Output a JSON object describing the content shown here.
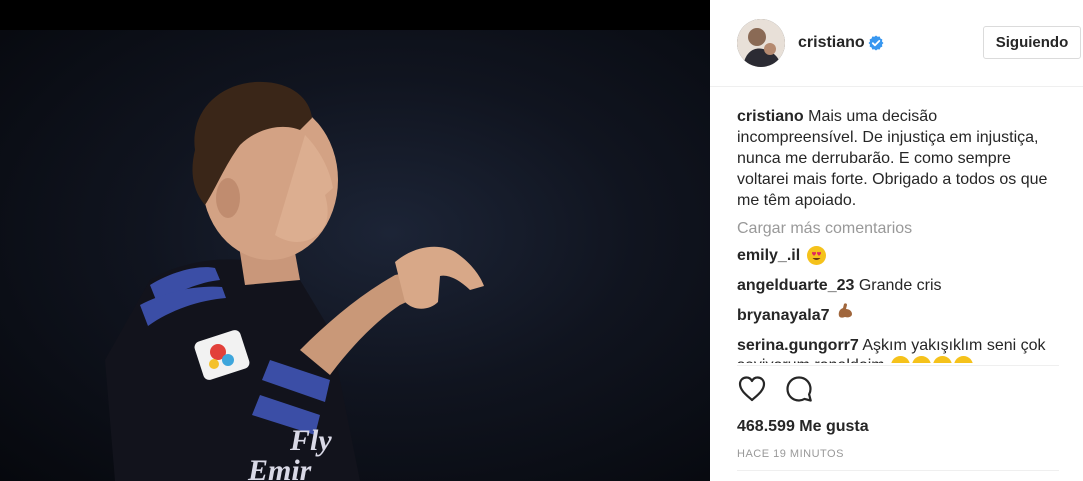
{
  "post": {
    "username": "cristiano",
    "follow_label": "Siguiendo",
    "caption_username": "cristiano",
    "caption_text": "Mais uma decisão incompreensível. De injustiça em injustiça, nunca me derrubarão. E como sempre voltarei mais forte. Obrigado a todos os que me têm apoiado.",
    "load_more": "Cargar más comentarios",
    "comments": [
      {
        "user": "emily_.il",
        "text": "",
        "emoji": [
          "heart-eyes"
        ]
      },
      {
        "user": "angelduarte_23",
        "text": "Grande cris",
        "emoji": []
      },
      {
        "user": "bryanayala7",
        "text": "",
        "emoji": [
          "flexed-biceps"
        ]
      },
      {
        "user": "serina.gungorr7",
        "text": "Aşkım yakışıklım seni çok seviyorum ronaldoim",
        "emoji": [
          "heart-eyes",
          "heart-eyes",
          "smile",
          "smile"
        ]
      }
    ],
    "likes": "468.599 Me gusta",
    "timestamp": "HACE 19 MINUTOS"
  },
  "jersey": {
    "sponsor_line1": "Fly",
    "sponsor_line2": "Emir"
  },
  "colors": {
    "verified_blue": "#3897f0",
    "text": "#262626",
    "muted": "#999999",
    "jersey_accent": "#3b4ea6"
  }
}
